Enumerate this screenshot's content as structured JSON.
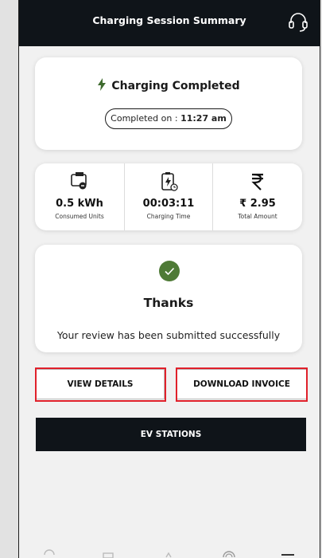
{
  "header": {
    "title": "Charging Session Summary",
    "support_icon": "headset-icon"
  },
  "status_card": {
    "title": "Charging Completed",
    "completed_prefix": "Completed on : ",
    "completed_time": "11:27 am",
    "icon": "lightning-bolt-icon",
    "icon_color": "#3f6b2f"
  },
  "stats": [
    {
      "icon": "charger-plug-icon",
      "value": "0.5 kWh",
      "label": "Consumed Units"
    },
    {
      "icon": "battery-timer-icon",
      "value": "00:03:11",
      "label": "Charging Time"
    },
    {
      "icon": "rupee-icon",
      "value": "₹ 2.95",
      "label": "Total Amount"
    }
  ],
  "thanks_card": {
    "icon": "check-circle-icon",
    "icon_color": "#4e7a36",
    "title": "Thanks",
    "message": "Your review has been submitted successfully"
  },
  "buttons": {
    "view_details": "VIEW DETAILS",
    "download_invoice": "DOWNLOAD INVOICE",
    "ev_stations": "EV STATIONS"
  },
  "colors": {
    "topbar": "#0f1419",
    "highlight": "#e0202a",
    "background": "#f1f1f1"
  },
  "bottom_nav": [
    "home-icon",
    "card-icon",
    "location-icon",
    "help-icon",
    "menu-icon"
  ]
}
